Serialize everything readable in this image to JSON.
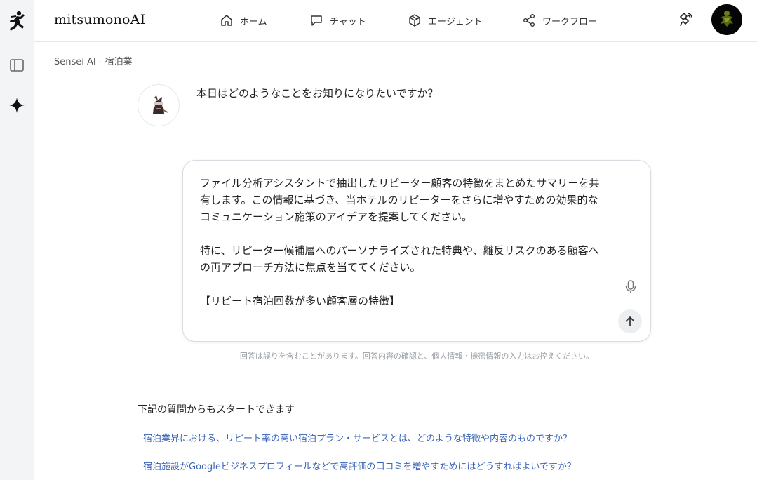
{
  "app": {
    "brand": "mitsumonoAI"
  },
  "nav": [
    {
      "label": "ホーム",
      "icon": "home-icon"
    },
    {
      "label": "チャット",
      "icon": "chat-icon"
    },
    {
      "label": "エージェント",
      "icon": "cube-icon"
    },
    {
      "label": "ワークフロー",
      "icon": "share-icon"
    }
  ],
  "breadcrumb": "Sensei AI - 宿泊業",
  "chat": {
    "bot_message": "本日はどのようなことをお知りになりたいですか？",
    "input_value": "ファイル分析アシスタントで抽出したリピーター顧客の特徴をまとめたサマリーを共有します。この情報に基づき、当ホテルのリピーターをさらに増やすための効果的なコミュニケーション施策のアイデアを提案してください。\n\n特に、リピーター候補層へのパーソナライズされた特典や、離反リスクのある顧客への再アプローチ方法に焦点を当ててください。\n\n【リピート宿泊回数が多い顧客層の特徴】",
    "disclaimer": "回答は誤りを含むことがあります。回答内容の確認と、個人情報・機密情報の入力はお控えください。"
  },
  "suggestions": {
    "title": "下記の質問からもスタートできます",
    "items": [
      "宿泊業界における、リピート率の高い宿泊プラン・サービスとは、どのような特徴や内容のものですか？",
      "宿泊施設がGoogleビジネスプロフィールなどで高評価の口コミを増やすためにはどうすればよいですか？"
    ]
  },
  "colors": {
    "link": "#3b64b8",
    "sidebar_bg": "#f3f4f6",
    "border": "#e5e7eb"
  }
}
